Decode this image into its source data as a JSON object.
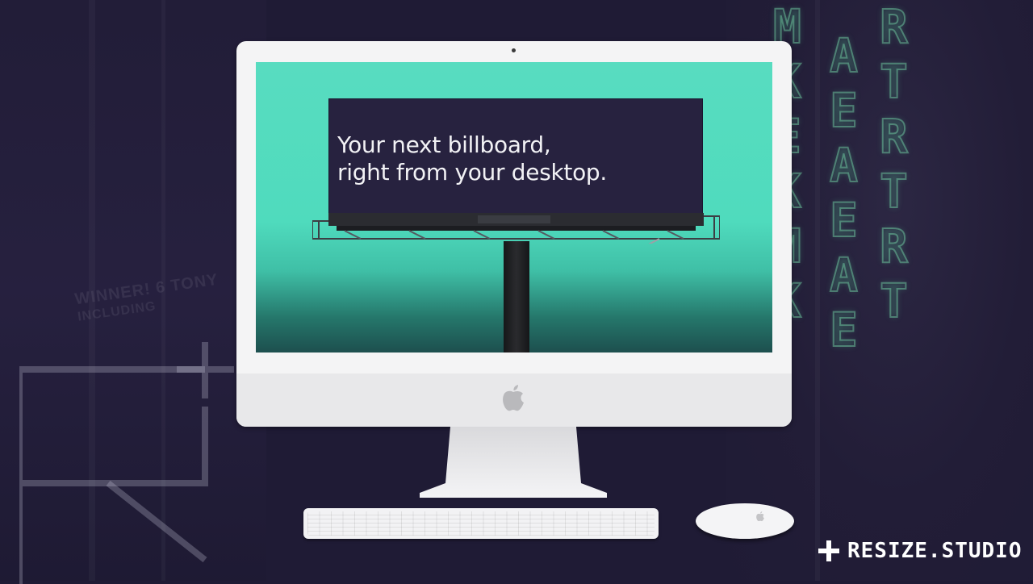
{
  "billboard": {
    "line1": "Your next billboard,",
    "line2": "right from your desktop."
  },
  "background": {
    "neon_letters_left": [
      "M",
      "K",
      "E",
      "K",
      "M",
      "K"
    ],
    "neon_letters_mid": [
      "A",
      "E",
      "A",
      "E",
      "A",
      "E"
    ],
    "neon_letters_right": [
      "R",
      "T",
      "R",
      "T",
      "R",
      "T"
    ],
    "faded_text_1": "WINNER! 6 TONY",
    "faded_text_2": "INCLUDING"
  },
  "brand": {
    "name": "RESIZE.STUDIO"
  },
  "colors": {
    "background": "#1f1b35",
    "screen_teal": "#4fdbbd",
    "billboard": "#27223f",
    "neon": "#78dcaa"
  }
}
